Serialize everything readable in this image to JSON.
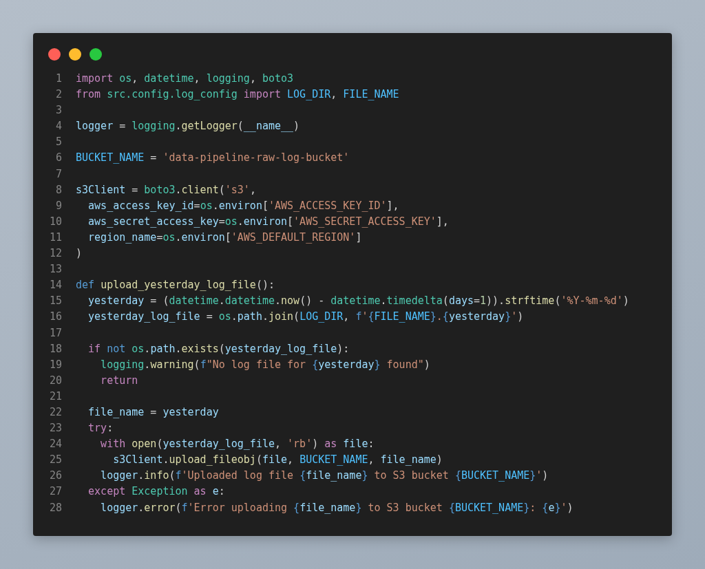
{
  "code": {
    "lines": [
      {
        "number": "1",
        "tokens": [
          {
            "t": "import ",
            "kind": "k"
          },
          {
            "t": "os",
            "kind": "m"
          },
          {
            "t": ", ",
            "kind": "p"
          },
          {
            "t": "datetime",
            "kind": "m"
          },
          {
            "t": ", ",
            "kind": "p"
          },
          {
            "t": "logging",
            "kind": "m"
          },
          {
            "t": ", ",
            "kind": "p"
          },
          {
            "t": "boto3",
            "kind": "m"
          }
        ]
      },
      {
        "number": "2",
        "tokens": [
          {
            "t": "from ",
            "kind": "k"
          },
          {
            "t": "src.config.log_config ",
            "kind": "m"
          },
          {
            "t": "import ",
            "kind": "k"
          },
          {
            "t": "LOG_DIR",
            "kind": "c"
          },
          {
            "t": ", ",
            "kind": "p"
          },
          {
            "t": "FILE_NAME",
            "kind": "c"
          }
        ]
      },
      {
        "number": "3"
      },
      {
        "number": "4",
        "tokens": [
          {
            "t": "logger",
            "kind": "v"
          },
          {
            "t": " = ",
            "kind": "p"
          },
          {
            "t": "logging",
            "kind": "m"
          },
          {
            "t": ".",
            "kind": "p"
          },
          {
            "t": "getLogger",
            "kind": "fn"
          },
          {
            "t": "(",
            "kind": "p"
          },
          {
            "t": "__name__",
            "kind": "v"
          },
          {
            "t": ")",
            "kind": "p"
          }
        ]
      },
      {
        "number": "5"
      },
      {
        "number": "6",
        "tokens": [
          {
            "t": "BUCKET_NAME",
            "kind": "c"
          },
          {
            "t": " = ",
            "kind": "p"
          },
          {
            "t": "'data-pipeline-raw-log-bucket'",
            "kind": "str"
          }
        ]
      },
      {
        "number": "7"
      },
      {
        "number": "8",
        "tokens": [
          {
            "t": "s3Client",
            "kind": "v"
          },
          {
            "t": " = ",
            "kind": "p"
          },
          {
            "t": "boto3",
            "kind": "m"
          },
          {
            "t": ".",
            "kind": "p"
          },
          {
            "t": "client",
            "kind": "fn"
          },
          {
            "t": "(",
            "kind": "p"
          },
          {
            "t": "'s3'",
            "kind": "str"
          },
          {
            "t": ",",
            "kind": "p"
          }
        ]
      },
      {
        "number": "9",
        "tokens": [
          {
            "t": "  aws_access_key_id",
            "kind": "v"
          },
          {
            "t": "=",
            "kind": "p"
          },
          {
            "t": "os",
            "kind": "m"
          },
          {
            "t": ".",
            "kind": "p"
          },
          {
            "t": "environ",
            "kind": "v"
          },
          {
            "t": "[",
            "kind": "p"
          },
          {
            "t": "'AWS_ACCESS_KEY_ID'",
            "kind": "str"
          },
          {
            "t": "],",
            "kind": "p"
          }
        ]
      },
      {
        "number": "10",
        "tokens": [
          {
            "t": "  aws_secret_access_key",
            "kind": "v"
          },
          {
            "t": "=",
            "kind": "p"
          },
          {
            "t": "os",
            "kind": "m"
          },
          {
            "t": ".",
            "kind": "p"
          },
          {
            "t": "environ",
            "kind": "v"
          },
          {
            "t": "[",
            "kind": "p"
          },
          {
            "t": "'AWS_SECRET_ACCESS_KEY'",
            "kind": "str"
          },
          {
            "t": "],",
            "kind": "p"
          }
        ]
      },
      {
        "number": "11",
        "tokens": [
          {
            "t": "  region_name",
            "kind": "v"
          },
          {
            "t": "=",
            "kind": "p"
          },
          {
            "t": "os",
            "kind": "m"
          },
          {
            "t": ".",
            "kind": "p"
          },
          {
            "t": "environ",
            "kind": "v"
          },
          {
            "t": "[",
            "kind": "p"
          },
          {
            "t": "'AWS_DEFAULT_REGION'",
            "kind": "str"
          },
          {
            "t": "]",
            "kind": "p"
          }
        ]
      },
      {
        "number": "12",
        "tokens": [
          {
            "t": ")",
            "kind": "p"
          }
        ]
      },
      {
        "number": "13"
      },
      {
        "number": "14",
        "tokens": [
          {
            "t": "def ",
            "kind": "s"
          },
          {
            "t": "upload_yesterday_log_file",
            "kind": "fn"
          },
          {
            "t": "():",
            "kind": "p"
          }
        ]
      },
      {
        "number": "15",
        "tokens": [
          {
            "t": "  yesterday",
            "kind": "v"
          },
          {
            "t": " = (",
            "kind": "p"
          },
          {
            "t": "datetime",
            "kind": "m"
          },
          {
            "t": ".",
            "kind": "p"
          },
          {
            "t": "datetime",
            "kind": "m"
          },
          {
            "t": ".",
            "kind": "p"
          },
          {
            "t": "now",
            "kind": "fn"
          },
          {
            "t": "() - ",
            "kind": "p"
          },
          {
            "t": "datetime",
            "kind": "m"
          },
          {
            "t": ".",
            "kind": "p"
          },
          {
            "t": "timedelta",
            "kind": "m"
          },
          {
            "t": "(",
            "kind": "p"
          },
          {
            "t": "days",
            "kind": "v"
          },
          {
            "t": "=",
            "kind": "p"
          },
          {
            "t": "1",
            "kind": "n"
          },
          {
            "t": ")).",
            "kind": "p"
          },
          {
            "t": "strftime",
            "kind": "fn"
          },
          {
            "t": "(",
            "kind": "p"
          },
          {
            "t": "'%Y-%m-%d'",
            "kind": "str"
          },
          {
            "t": ")",
            "kind": "p"
          }
        ]
      },
      {
        "number": "16",
        "tokens": [
          {
            "t": "  yesterday_log_file",
            "kind": "v"
          },
          {
            "t": " = ",
            "kind": "p"
          },
          {
            "t": "os",
            "kind": "m"
          },
          {
            "t": ".",
            "kind": "p"
          },
          {
            "t": "path",
            "kind": "v"
          },
          {
            "t": ".",
            "kind": "p"
          },
          {
            "t": "join",
            "kind": "fn"
          },
          {
            "t": "(",
            "kind": "p"
          },
          {
            "t": "LOG_DIR",
            "kind": "c"
          },
          {
            "t": ", ",
            "kind": "p"
          },
          {
            "t": "f",
            "kind": "s"
          },
          {
            "t": "'",
            "kind": "str"
          },
          {
            "t": "{",
            "kind": "b"
          },
          {
            "t": "FILE_NAME",
            "kind": "c"
          },
          {
            "t": "}",
            "kind": "b"
          },
          {
            "t": ".",
            "kind": "str"
          },
          {
            "t": "{",
            "kind": "b"
          },
          {
            "t": "yesterday",
            "kind": "v"
          },
          {
            "t": "}",
            "kind": "b"
          },
          {
            "t": "'",
            "kind": "str"
          },
          {
            "t": ")",
            "kind": "p"
          }
        ]
      },
      {
        "number": "17"
      },
      {
        "number": "18",
        "tokens": [
          {
            "t": "  if ",
            "kind": "k"
          },
          {
            "t": "not ",
            "kind": "s"
          },
          {
            "t": "os",
            "kind": "m"
          },
          {
            "t": ".",
            "kind": "p"
          },
          {
            "t": "path",
            "kind": "v"
          },
          {
            "t": ".",
            "kind": "p"
          },
          {
            "t": "exists",
            "kind": "fn"
          },
          {
            "t": "(",
            "kind": "p"
          },
          {
            "t": "yesterday_log_file",
            "kind": "v"
          },
          {
            "t": "):",
            "kind": "p"
          }
        ]
      },
      {
        "number": "19",
        "tokens": [
          {
            "t": "    logging",
            "kind": "m"
          },
          {
            "t": ".",
            "kind": "p"
          },
          {
            "t": "warning",
            "kind": "fn"
          },
          {
            "t": "(",
            "kind": "p"
          },
          {
            "t": "f",
            "kind": "s"
          },
          {
            "t": "\"No log file for ",
            "kind": "str"
          },
          {
            "t": "{",
            "kind": "b"
          },
          {
            "t": "yesterday",
            "kind": "v"
          },
          {
            "t": "}",
            "kind": "b"
          },
          {
            "t": " found\"",
            "kind": "str"
          },
          {
            "t": ")",
            "kind": "p"
          }
        ]
      },
      {
        "number": "20",
        "tokens": [
          {
            "t": "    return",
            "kind": "k"
          }
        ]
      },
      {
        "number": "21"
      },
      {
        "number": "22",
        "tokens": [
          {
            "t": "  file_name",
            "kind": "v"
          },
          {
            "t": " = ",
            "kind": "p"
          },
          {
            "t": "yesterday",
            "kind": "v"
          }
        ]
      },
      {
        "number": "23",
        "tokens": [
          {
            "t": "  try",
            "kind": "k"
          },
          {
            "t": ":",
            "kind": "p"
          }
        ]
      },
      {
        "number": "24",
        "tokens": [
          {
            "t": "    with ",
            "kind": "k"
          },
          {
            "t": "open",
            "kind": "fn"
          },
          {
            "t": "(",
            "kind": "p"
          },
          {
            "t": "yesterday_log_file",
            "kind": "v"
          },
          {
            "t": ", ",
            "kind": "p"
          },
          {
            "t": "'rb'",
            "kind": "str"
          },
          {
            "t": ") ",
            "kind": "p"
          },
          {
            "t": "as ",
            "kind": "k"
          },
          {
            "t": "file",
            "kind": "v"
          },
          {
            "t": ":",
            "kind": "p"
          }
        ]
      },
      {
        "number": "25",
        "tokens": [
          {
            "t": "      s3Client",
            "kind": "v"
          },
          {
            "t": ".",
            "kind": "p"
          },
          {
            "t": "upload_fileobj",
            "kind": "fn"
          },
          {
            "t": "(",
            "kind": "p"
          },
          {
            "t": "file",
            "kind": "v"
          },
          {
            "t": ", ",
            "kind": "p"
          },
          {
            "t": "BUCKET_NAME",
            "kind": "c"
          },
          {
            "t": ", ",
            "kind": "p"
          },
          {
            "t": "file_name",
            "kind": "v"
          },
          {
            "t": ")",
            "kind": "p"
          }
        ]
      },
      {
        "number": "26",
        "tokens": [
          {
            "t": "    logger",
            "kind": "v"
          },
          {
            "t": ".",
            "kind": "p"
          },
          {
            "t": "info",
            "kind": "fn"
          },
          {
            "t": "(",
            "kind": "p"
          },
          {
            "t": "f",
            "kind": "s"
          },
          {
            "t": "'Uploaded log file ",
            "kind": "str"
          },
          {
            "t": "{",
            "kind": "b"
          },
          {
            "t": "file_name",
            "kind": "v"
          },
          {
            "t": "}",
            "kind": "b"
          },
          {
            "t": " to S3 bucket ",
            "kind": "str"
          },
          {
            "t": "{",
            "kind": "b"
          },
          {
            "t": "BUCKET_NAME",
            "kind": "c"
          },
          {
            "t": "}",
            "kind": "b"
          },
          {
            "t": "'",
            "kind": "str"
          },
          {
            "t": ")",
            "kind": "p"
          }
        ]
      },
      {
        "number": "27",
        "tokens": [
          {
            "t": "  except ",
            "kind": "k"
          },
          {
            "t": "Exception ",
            "kind": "m"
          },
          {
            "t": "as ",
            "kind": "k"
          },
          {
            "t": "e",
            "kind": "v"
          },
          {
            "t": ":",
            "kind": "p"
          }
        ]
      },
      {
        "number": "28",
        "tokens": [
          {
            "t": "    logger",
            "kind": "v"
          },
          {
            "t": ".",
            "kind": "p"
          },
          {
            "t": "error",
            "kind": "fn"
          },
          {
            "t": "(",
            "kind": "p"
          },
          {
            "t": "f",
            "kind": "s"
          },
          {
            "t": "'Error uploading ",
            "kind": "str"
          },
          {
            "t": "{",
            "kind": "b"
          },
          {
            "t": "file_name",
            "kind": "v"
          },
          {
            "t": "}",
            "kind": "b"
          },
          {
            "t": " to S3 bucket ",
            "kind": "str"
          },
          {
            "t": "{",
            "kind": "b"
          },
          {
            "t": "BUCKET_NAME",
            "kind": "c"
          },
          {
            "t": "}",
            "kind": "b"
          },
          {
            "t": ": ",
            "kind": "str"
          },
          {
            "t": "{",
            "kind": "b"
          },
          {
            "t": "e",
            "kind": "v"
          },
          {
            "t": "}",
            "kind": "b"
          },
          {
            "t": "'",
            "kind": "str"
          },
          {
            "t": ")",
            "kind": "p"
          }
        ]
      }
    ]
  }
}
